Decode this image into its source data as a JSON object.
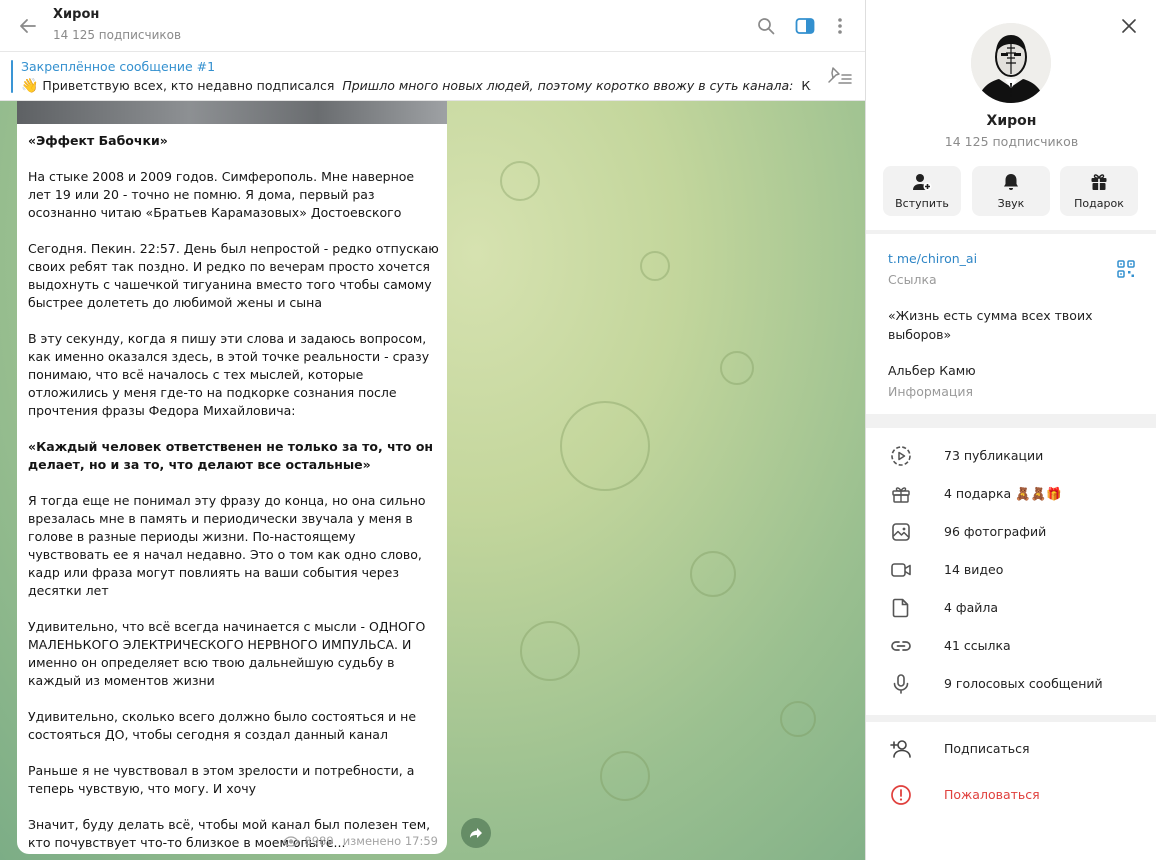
{
  "chat": {
    "title": "Хирон",
    "subscribers": "14 125 подписчиков"
  },
  "pinned": {
    "title": "Закреплённое сообщение #1",
    "emoji": "👋",
    "text_plain": "Приветствую всех, кто недавно подписался",
    "text_italic": "Пришло много новых людей, поэтому коротко ввожу в суть канала:",
    "text_tail": "Ключев..."
  },
  "message": {
    "title": "«Эффект Бабочки»",
    "p1": "На стыке 2008 и 2009 годов. Симферополь. Мне наверное лет 19 или 20 - точно не помню. Я дома, первый раз осознанно читаю «Братьев Карамазовых» Достоевского",
    "p2": "Сегодня. Пекин. 22:57. День был непростой - редко отпускаю своих ребят так поздно. И редко по вечерам просто хочется выдохнуть с чашечкой тигуанинa вместо того чтобы самому быстрее долететь до любимой жены и сына",
    "p3": "В эту секунду, когда я пишу эти слова и задаюсь вопросом, как именно оказался здесь, в этой точке реальности - сразу понимаю, что всё началось с тех мыслей, которые отложились у меня где-то на подкорке сознания после прочтения фразы Федора Михайловича:",
    "quote": "«Каждый человек ответственен не только за то, что он делает, но и за то, что делают все остальные»",
    "p4": "Я тогда еще не понимал эту фразу до конца, но она сильно врезалась мне в память и периодически звучала у меня в голове в разные периоды жизни. По-настоящему чувствовать ее я начал недавно. Это о том как одно слово, кадр или фраза могут повлиять на ваши события через десятки лет",
    "p5": "Удивительно, что всё всегда начинается с мысли - ОДНОГО МАЛЕНЬКОГО ЭЛЕКТРИЧЕСКОГО НЕРВНОГО ИМПУЛЬСА. И именно он определяет всю твою дальнейшую судьбу в каждый из моментов жизни",
    "p6": "Удивительно, сколько всего должно было состояться и не состояться ДО, чтобы сегодня я создал данный канал",
    "p7": "Раньше я не чувствовал в этом зрелости и потребности, а теперь чувствую, что могу. И хочу",
    "p8": "Значит, буду делать всё, чтобы мой канал был полезен тем, кто почувствует что-то близкое в моем опыте...",
    "views": "8989",
    "edited": "изменено 17:59"
  },
  "profile": {
    "name": "Хирон",
    "subscribers": "14 125 подписчиков",
    "buttons": {
      "join": "Вступить",
      "sound": "Звук",
      "gift": "Подарок"
    },
    "link": "t.me/chiron_ai",
    "link_label": "Ссылка",
    "bio_line1": "«Жизнь есть сумма всех твоих выборов»",
    "bio_line2": "Альбер Камю",
    "bio_label": "Информация"
  },
  "media": {
    "posts": "73 публикации",
    "gifts": "4 подарка",
    "gift_emojis": "🧸🧸🎁",
    "photos": "96 фотографий",
    "videos": "14 видео",
    "files": "4 файла",
    "links": "41 ссылка",
    "voice": "9 голосовых сообщений"
  },
  "actions": {
    "subscribe": "Подписаться",
    "report": "Пожаловаться"
  },
  "colors": {
    "accent": "#3390cf",
    "danger": "#e0403d"
  }
}
